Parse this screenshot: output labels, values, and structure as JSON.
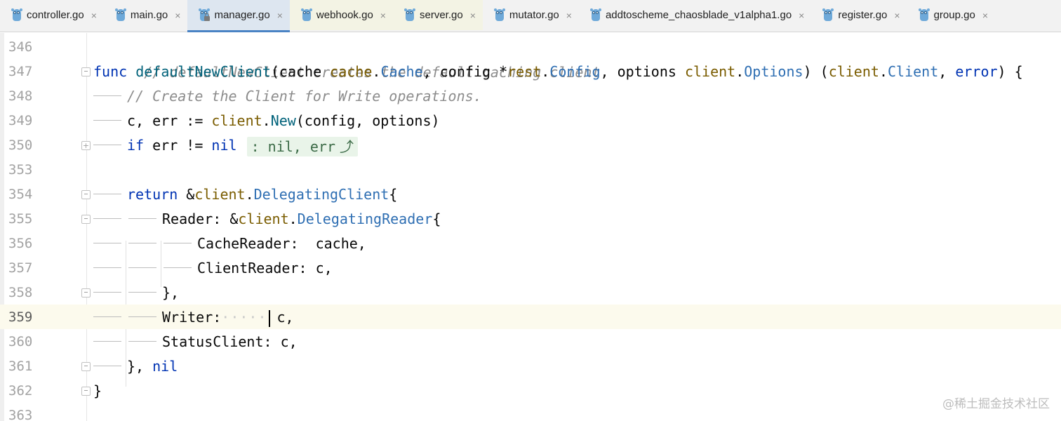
{
  "tabs": [
    {
      "label": "controller.go",
      "active": false,
      "modified": false
    },
    {
      "label": "main.go",
      "active": false,
      "modified": false
    },
    {
      "label": "manager.go",
      "active": true,
      "modified": false
    },
    {
      "label": "webhook.go",
      "active": false,
      "modified": true
    },
    {
      "label": "server.go",
      "active": false,
      "modified": true
    },
    {
      "label": "mutator.go",
      "active": false,
      "modified": false
    },
    {
      "label": "addtoscheme_chaosblade_v1alpha1.go",
      "active": false,
      "modified": false
    },
    {
      "label": "register.go",
      "active": false,
      "modified": false
    },
    {
      "label": "group.go",
      "active": false,
      "modified": false
    }
  ],
  "tab_close_glyph": "×",
  "editor": {
    "current_line": "359",
    "lines": [
      {
        "num": "346"
      },
      {
        "num": "347"
      },
      {
        "num": "348"
      },
      {
        "num": "349"
      },
      {
        "num": "350"
      },
      {
        "num": "353"
      },
      {
        "num": "354"
      },
      {
        "num": "355"
      },
      {
        "num": "356"
      },
      {
        "num": "357"
      },
      {
        "num": "358"
      },
      {
        "num": "359"
      },
      {
        "num": "360"
      },
      {
        "num": "361"
      },
      {
        "num": "362"
      },
      {
        "num": "363"
      }
    ],
    "code": {
      "l346_comment": "// defaultNewClient creates the default caching client",
      "l347_func": "func",
      "l347_name": "defaultNewClient",
      "l347_p1": "(cache ",
      "l347_pkg1": "cache",
      "l347_dot1": ".",
      "l347_typ1": "Cache",
      "l347_p2": ", config *",
      "l347_pkg2": "rest",
      "l347_dot2": ".",
      "l347_typ2": "Config",
      "l347_p3": ", options ",
      "l347_pkg3": "client",
      "l347_dot3": ".",
      "l347_typ3": "Options",
      "l347_p4": ") (",
      "l347_pkg4": "client",
      "l347_dot4": ".",
      "l347_typ4": "Client",
      "l347_p5": ", ",
      "l347_typ5": "error",
      "l347_p6": ") {",
      "l348_comment": "// Create the Client for Write operations.",
      "l349_a": "c, err := ",
      "l349_pkg": "client",
      "l349_dot": ".",
      "l349_fn": "New",
      "l349_b": "(config, options)",
      "l350_if": "if",
      "l350_a": " err != ",
      "l350_nil": "nil",
      "l350_hint": ": nil, err",
      "l350_arrow": "⤴",
      "l354_return": "return",
      "l354_a": " &",
      "l354_pkg": "client",
      "l354_dot": ".",
      "l354_typ": "DelegatingClient",
      "l354_b": "{",
      "l355_a": "Reader: &",
      "l355_pkg": "client",
      "l355_dot": ".",
      "l355_typ": "DelegatingReader",
      "l355_b": "{",
      "l356": "CacheReader:  cache,",
      "l357": "ClientReader: c,",
      "l358": "},",
      "l359_a": "Writer:",
      "l359_dots": "·····",
      "l359_b": "c,",
      "l360": "StatusClient: c,",
      "l361_a": "}, ",
      "l361_nil": "nil",
      "l362": "}"
    }
  },
  "watermark": "@稀土掘金技术社区"
}
